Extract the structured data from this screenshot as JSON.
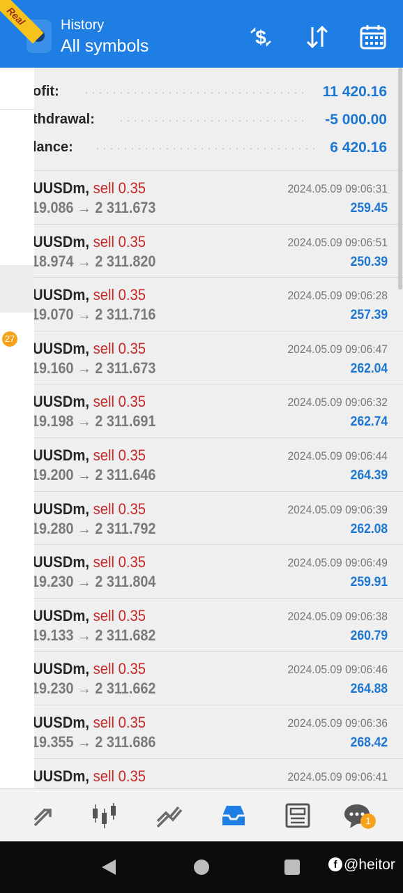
{
  "header": {
    "subtitle": "History",
    "title": "All symbols",
    "badge": "Real",
    "icons": [
      "deposit-dollar-icon",
      "sort-icon",
      "calendar-icon"
    ]
  },
  "sidebar": {
    "notification_count": "27"
  },
  "summary": {
    "rows": [
      {
        "label": "ofit:",
        "value": "11 420.16"
      },
      {
        "label": "thdrawal:",
        "value": "-5 000.00"
      },
      {
        "label": "lance:",
        "value": "6 420.16"
      }
    ]
  },
  "trades": [
    {
      "symbol": "UUSDm,",
      "side": "sell 0.35",
      "prices": "19.086 → 2 311.673",
      "time": "2024.05.09 09:06:31",
      "profit": "259.45"
    },
    {
      "symbol": "UUSDm,",
      "side": "sell 0.35",
      "prices": "18.974 → 2 311.820",
      "time": "2024.05.09 09:06:51",
      "profit": "250.39"
    },
    {
      "symbol": "UUSDm,",
      "side": "sell 0.35",
      "prices": "19.070 → 2 311.716",
      "time": "2024.05.09 09:06:28",
      "profit": "257.39"
    },
    {
      "symbol": "UUSDm,",
      "side": "sell 0.35",
      "prices": "19.160 → 2 311.673",
      "time": "2024.05.09 09:06:47",
      "profit": "262.04"
    },
    {
      "symbol": "UUSDm,",
      "side": "sell 0.35",
      "prices": "19.198 → 2 311.691",
      "time": "2024.05.09 09:06:32",
      "profit": "262.74"
    },
    {
      "symbol": "UUSDm,",
      "side": "sell 0.35",
      "prices": "19.200 → 2 311.646",
      "time": "2024.05.09 09:06:44",
      "profit": "264.39"
    },
    {
      "symbol": "UUSDm,",
      "side": "sell 0.35",
      "prices": "19.280 → 2 311.792",
      "time": "2024.05.09 09:06:39",
      "profit": "262.08"
    },
    {
      "symbol": "UUSDm,",
      "side": "sell 0.35",
      "prices": "19.230 → 2 311.804",
      "time": "2024.05.09 09:06:49",
      "profit": "259.91"
    },
    {
      "symbol": "UUSDm,",
      "side": "sell 0.35",
      "prices": "19.133 → 2 311.682",
      "time": "2024.05.09 09:06:38",
      "profit": "260.79"
    },
    {
      "symbol": "UUSDm,",
      "side": "sell 0.35",
      "prices": "19.230 → 2 311.662",
      "time": "2024.05.09 09:06:46",
      "profit": "264.88"
    },
    {
      "symbol": "UUSDm,",
      "side": "sell 0.35",
      "prices": "19.355 → 2 311.686",
      "time": "2024.05.09 09:06:36",
      "profit": "268.42"
    },
    {
      "symbol": "UUSDm,",
      "side": "sell 0.35",
      "prices": "",
      "time": "2024.05.09 09:06:41",
      "profit": ""
    }
  ],
  "tabbar": {
    "tabs": [
      "trade-icon",
      "quotes-candles-icon",
      "chart-icon",
      "history-inbox-icon",
      "news-icon",
      "chat-icon"
    ],
    "active_tab": "history-inbox-icon",
    "chat_badge": "1"
  },
  "navbar": {
    "watermark": "@heitor"
  },
  "colors": {
    "header": "#1e7ee3",
    "profit_blue": "#1b77d1",
    "sell_red": "#c62828",
    "badge_orange": "#f5a31a"
  }
}
